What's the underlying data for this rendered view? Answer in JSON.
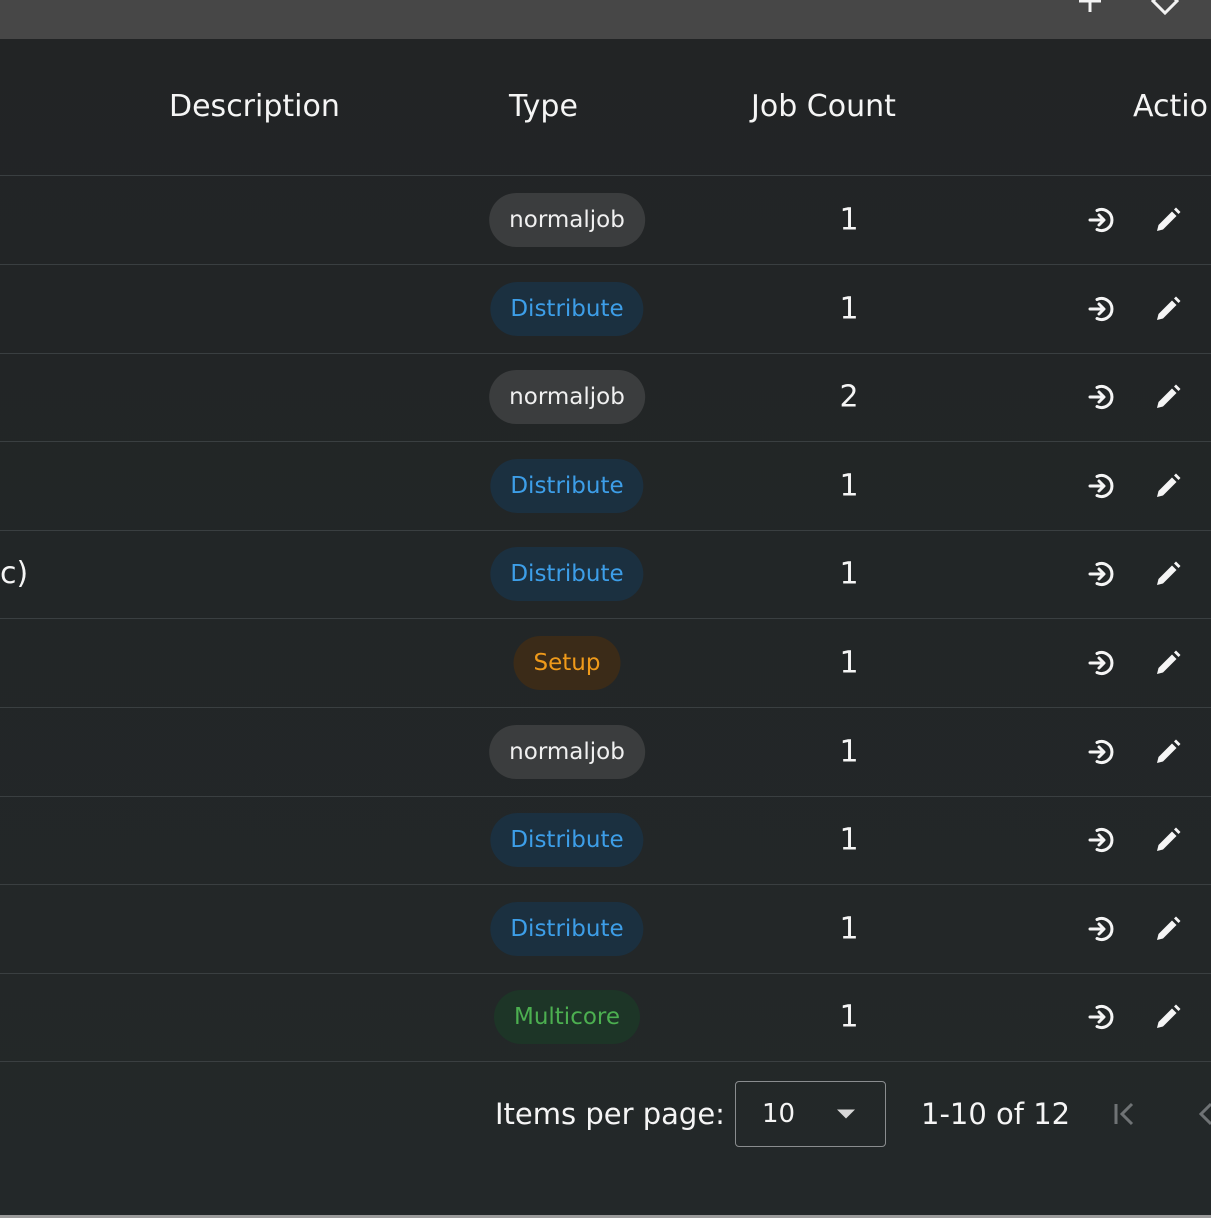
{
  "table": {
    "headers": {
      "description": "Description",
      "type": "Type",
      "job_count": "Job Count",
      "actions": "Actio"
    },
    "rows": [
      {
        "description": "",
        "type": "normaljob",
        "type_style": "normaljob",
        "job_count": "1"
      },
      {
        "description": "",
        "type": "Distribute",
        "type_style": "distribute",
        "job_count": "1"
      },
      {
        "description": "",
        "type": "normaljob",
        "type_style": "normaljob",
        "job_count": "2"
      },
      {
        "description": "",
        "type": "Distribute",
        "type_style": "distribute",
        "job_count": "1"
      },
      {
        "description": "c)",
        "type": "Distribute",
        "type_style": "distribute",
        "job_count": "1"
      },
      {
        "description": "",
        "type": "Setup",
        "type_style": "setup",
        "job_count": "1"
      },
      {
        "description": "",
        "type": "normaljob",
        "type_style": "normaljob",
        "job_count": "1"
      },
      {
        "description": "",
        "type": "Distribute",
        "type_style": "distribute",
        "job_count": "1"
      },
      {
        "description": "",
        "type": "Distribute",
        "type_style": "distribute",
        "job_count": "1"
      },
      {
        "description": "",
        "type": "Multicore",
        "type_style": "multicore",
        "job_count": "1"
      }
    ],
    "row_action_icons": [
      "login-icon",
      "edit-pencil-icon"
    ]
  },
  "paginator": {
    "items_per_page_label": "Items per page:",
    "items_per_page_value": "10",
    "range_label": "1-10 of 12",
    "icons": [
      "first-page-icon",
      "previous-page-icon"
    ]
  },
  "colors": {
    "background": "#232829",
    "topbar": "#474747",
    "distribute_text": "#3d9ee8",
    "setup_text": "#ef9a1a",
    "multicore_text": "#4caf50"
  }
}
